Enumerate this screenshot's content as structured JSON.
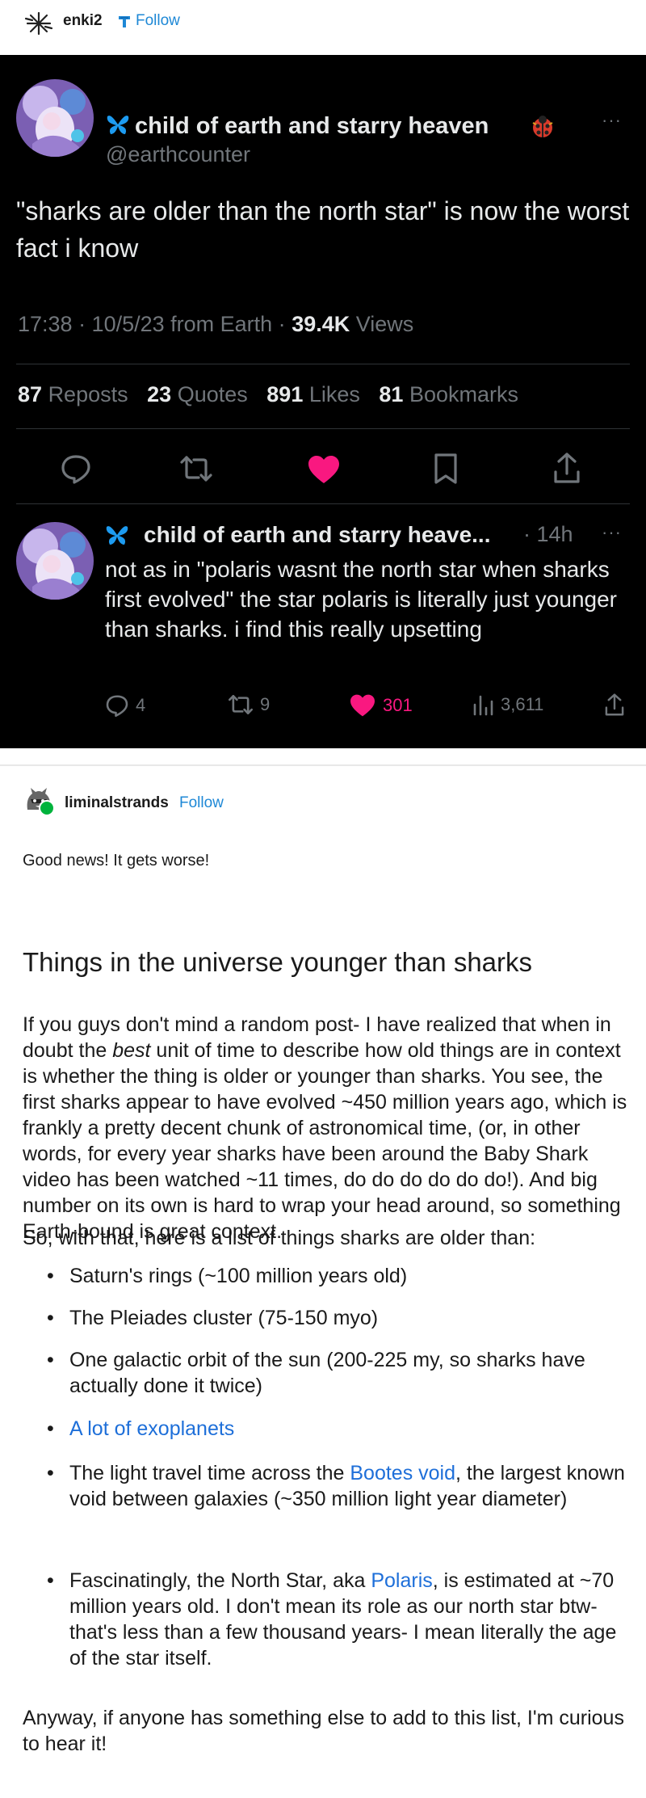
{
  "header": {
    "username": "enki2",
    "follow_label": "Follow",
    "avatar_icon": "sparkle-burst-icon",
    "sub_icon": "tumblr-badge-icon"
  },
  "tweet": {
    "display_name": "child of earth and starry heaven",
    "handle": "@earthcounter",
    "more": "···",
    "text": "\"sharks are older than the north star\" is now the worst fact i know",
    "time": "17:38 · 10/5/23 from Earth · ",
    "views_count": "39.4K",
    "views_label": " Views",
    "stats": {
      "reposts_count": "87",
      "reposts_label": "Reposts",
      "quotes_count": "23",
      "quotes_label": "Quotes",
      "likes_count": "891",
      "likes_label": "Likes",
      "bookmarks_count": "81",
      "bookmarks_label": "Bookmarks"
    },
    "actions": [
      "reply-icon",
      "repost-icon",
      "heart-icon",
      "bookmark-icon",
      "share-icon"
    ],
    "colors": {
      "background": "#000000",
      "like": "#f91880",
      "text": "#e7e9ea",
      "muted": "#71767b"
    }
  },
  "reply": {
    "display_name": "child of earth and starry heave...",
    "time": "· 14h",
    "more": "···",
    "text": "not as in \"polaris wasnt the north star when sharks first evolved\" the star polaris is literally just younger than sharks. i find this really upsetting",
    "replies": "4",
    "reposts": "9",
    "likes": "301",
    "views": "3,611"
  },
  "post2": {
    "username": "liminalstrands",
    "follow_label": "Follow",
    "lead": "Good news! It gets worse!",
    "title": "Things in the universe younger than sharks",
    "para1_a": "If you guys don't mind a random post- I have realized that when in doubt the ",
    "para1_em": "best",
    "para1_b": " unit of time to describe how old things are in context is whether the thing is older or younger than sharks. You see, the first sharks appear to have evolved ~450 million years ago, which is frankly a pretty decent chunk of astronomical time, (or, in other words, for every year sharks have been around the Baby Shark video has been watched ~11 times, do do do do do do!). And big number on its own is hard to wrap your head around, so something Earth-bound is great context.",
    "para2": "So, with that, here is a list of things sharks are older than:",
    "bullets": {
      "b1": "Saturn's rings (~100 million years old)",
      "b2": "The Pleiades cluster (75-150 myo)",
      "b3": "One galactic orbit of the sun (200-225 my, so sharks have actually done it twice)",
      "b4_link": "A lot of exoplanets",
      "b5_a": "The light travel time across the ",
      "b5_link": "Bootes void",
      "b5_b": ", the largest known void between galaxies (~350 million light year diameter)",
      "b6_a": "Fascinatingly, the North Star, aka ",
      "b6_link": "Polaris",
      "b6_b": ", is estimated at ~70 million years old. I don't mean its role as our north star btw- that's less than a few thousand years- I mean literally the age of the star itself."
    },
    "closing": "Anyway, if anyone has something else to add to this list, I'm curious to hear it!",
    "link_color": "#1e6fd9"
  }
}
